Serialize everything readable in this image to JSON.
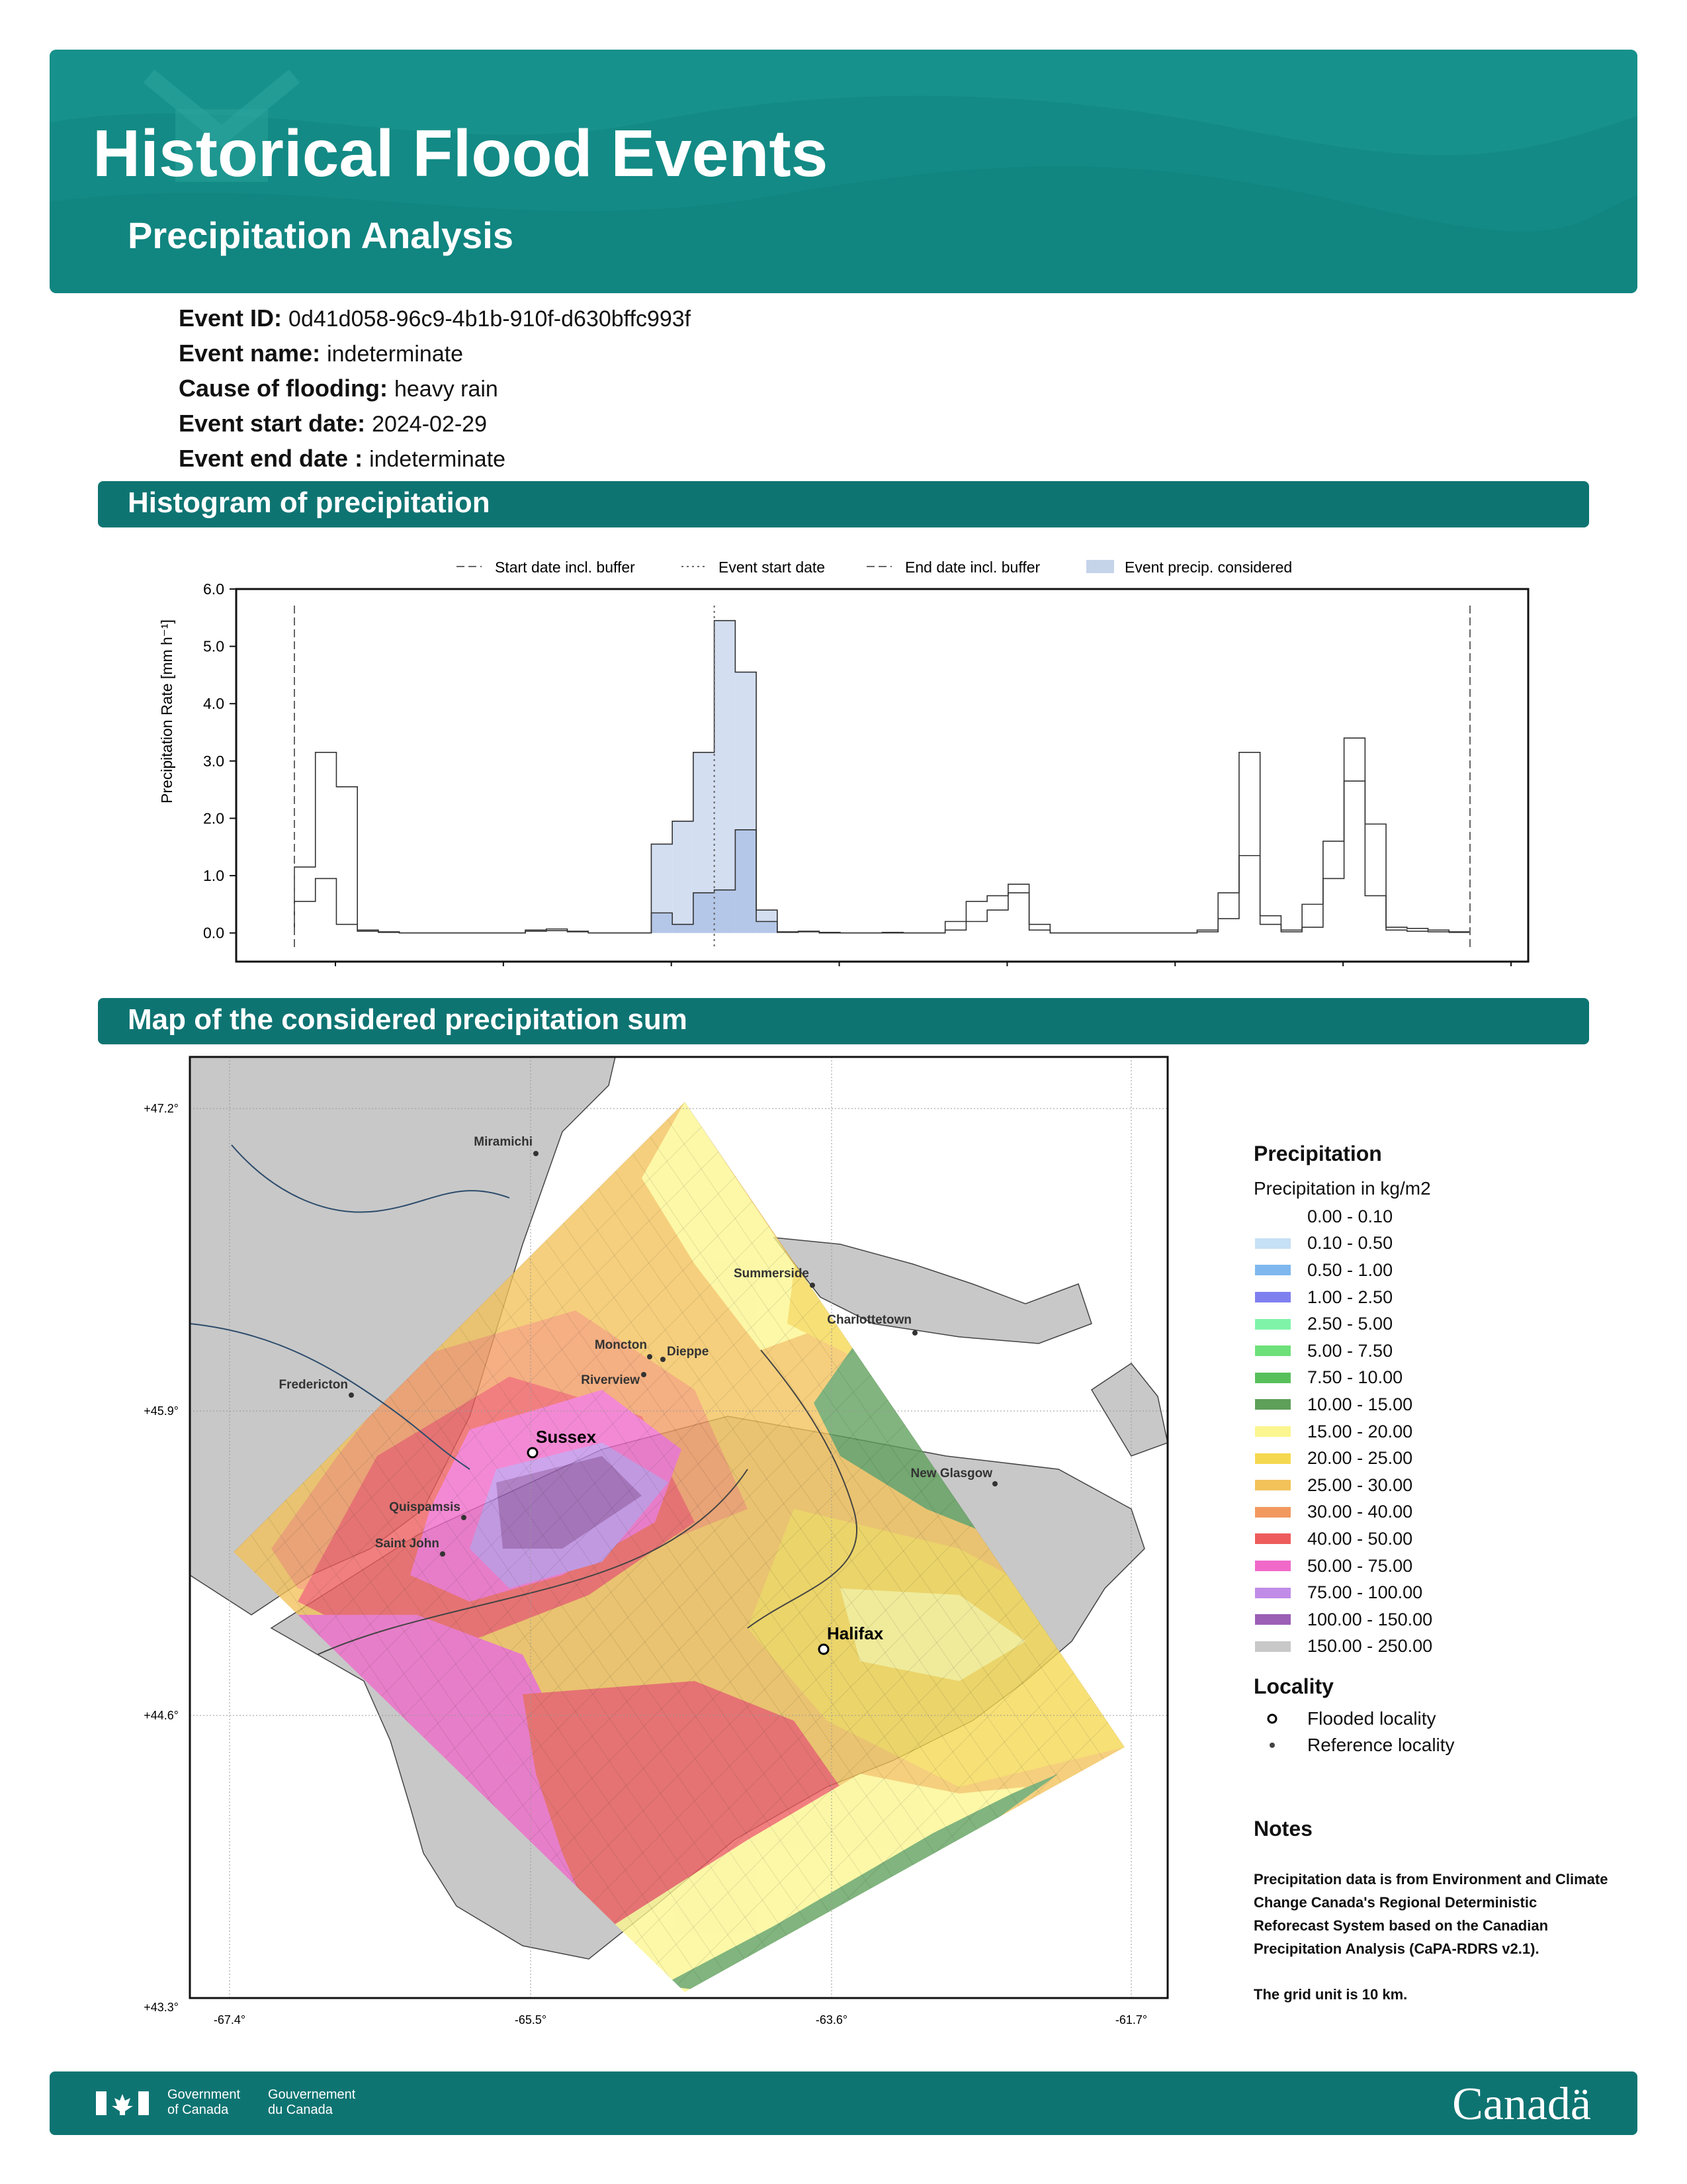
{
  "header": {
    "title": "Historical Flood Events",
    "subtitle": "Precipitation Analysis"
  },
  "event": {
    "id_label": "Event ID:",
    "id": "0d41d058-96c9-4b1b-910f-d630bffc993f",
    "name_label": "Event name:",
    "name": "indeterminate",
    "cause_label": "Cause of flooding:",
    "cause": "heavy rain",
    "start_label": "Event start date:",
    "start": "2024-02-29",
    "end_label": "Event end date :",
    "end": "indeterminate"
  },
  "sections": {
    "histogram": "Histogram of precipitation",
    "map": "Map of the considered precipitation sum"
  },
  "chart_data": {
    "type": "bar",
    "title": "",
    "xlabel": "",
    "ylabel": "Precipitation Rate [mm h⁻¹]",
    "ylim": [
      -0.5,
      6.0
    ],
    "yticks": [
      "0.0",
      "1.0",
      "2.0",
      "3.0",
      "4.0",
      "5.0",
      "6.0"
    ],
    "legend_position": "top-center",
    "legend": [
      "Start date incl. buffer",
      "Event start date",
      "End date incl. buffer",
      "Event precip. considered"
    ],
    "x_unit": "hour index (3-hourly bins)",
    "x_range": [
      0,
      56
    ],
    "markers": {
      "start_buffer": 0,
      "event_start": 20,
      "end_buffer": 56
    },
    "series": [
      {
        "values": [
          1.15,
          3.15,
          2.55,
          0.05,
          0.02,
          0.0,
          0.0,
          0.0,
          0.0,
          0.0,
          0.0,
          0.05,
          0.07,
          0.03,
          0.0,
          0.0,
          0.0,
          1.55,
          1.95,
          3.15,
          5.45,
          4.55,
          0.4,
          0.02,
          0.03,
          0.01,
          0.0,
          0.0,
          0.01,
          0.0,
          0.0,
          0.2,
          0.55,
          0.65,
          0.85,
          0.15,
          0.0,
          0.0,
          0.0,
          0.0,
          0.0,
          0.0,
          0.0,
          0.05,
          0.7,
          3.15,
          0.3,
          0.05,
          0.5,
          1.6,
          3.4,
          1.9,
          0.1,
          0.08,
          0.05,
          0.02
        ]
      },
      {
        "values": [
          0.55,
          0.95,
          0.15,
          0.03,
          0.01,
          0.0,
          0.0,
          0.0,
          0.0,
          0.0,
          0.0,
          0.03,
          0.04,
          0.02,
          0.0,
          0.0,
          0.0,
          0.35,
          0.15,
          0.7,
          0.75,
          1.8,
          0.2,
          0.01,
          0.02,
          0.0,
          0.0,
          0.0,
          0.0,
          0.0,
          0.0,
          0.05,
          0.2,
          0.4,
          0.7,
          0.05,
          0.0,
          0.0,
          0.0,
          0.0,
          0.0,
          0.0,
          0.0,
          0.02,
          0.25,
          1.35,
          0.15,
          0.02,
          0.1,
          0.95,
          2.65,
          0.65,
          0.05,
          0.03,
          0.02,
          0.01
        ]
      }
    ],
    "considered_range": [
      17,
      23
    ]
  },
  "map": {
    "lat_ticks": [
      "+47.2°",
      "+45.9°",
      "+44.6°",
      "+43.3°"
    ],
    "lon_ticks": [
      "-67.4°",
      "-65.5°",
      "-63.6°",
      "-61.7°"
    ],
    "flooded": [
      {
        "name": "Sussex"
      },
      {
        "name": "Halifax"
      }
    ],
    "reference": [
      {
        "name": "Miramichi"
      },
      {
        "name": "Summerside"
      },
      {
        "name": "Charlottetown"
      },
      {
        "name": "Moncton"
      },
      {
        "name": "Dieppe"
      },
      {
        "name": "Riverview"
      },
      {
        "name": "Fredericton"
      },
      {
        "name": "Quispamsis"
      },
      {
        "name": "Saint John"
      },
      {
        "name": "New Glasgow"
      }
    ]
  },
  "legend": {
    "title": "Precipitation",
    "subtitle": "Precipitation in kg/m2",
    "classes": [
      {
        "label": "0.00 - 0.10",
        "color": "#ffffff"
      },
      {
        "label": "0.10 - 0.50",
        "color": "#c6e0f5"
      },
      {
        "label": "0.50 - 1.00",
        "color": "#7fb8ee"
      },
      {
        "label": "1.00 - 2.50",
        "color": "#7f7ff0"
      },
      {
        "label": "2.50 - 5.00",
        "color": "#7ff4a8"
      },
      {
        "label": "5.00 - 7.50",
        "color": "#6ee07a"
      },
      {
        "label": "7.50 - 10.00",
        "color": "#58c05a"
      },
      {
        "label": "10.00 - 15.00",
        "color": "#5e9f5a"
      },
      {
        "label": "15.00 - 20.00",
        "color": "#fbf68f"
      },
      {
        "label": "20.00 - 25.00",
        "color": "#f5d850"
      },
      {
        "label": "25.00 - 30.00",
        "color": "#f3c259"
      },
      {
        "label": "30.00 - 40.00",
        "color": "#f29960"
      },
      {
        "label": "40.00 - 50.00",
        "color": "#ee5c5c"
      },
      {
        "label": "50.00 - 75.00",
        "color": "#f069c9"
      },
      {
        "label": "75.00 - 100.00",
        "color": "#c08ce8"
      },
      {
        "label": "100.00 - 150.00",
        "color": "#9b5fb5"
      },
      {
        "label": "150.00 - 250.00",
        "color": "#c8c8c8"
      }
    ],
    "locality_title": "Locality",
    "flooded_label": "Flooded locality",
    "reference_label": "Reference locality",
    "notes_title": "Notes",
    "notes_text": "Precipitation data is from Environment and Climate Change Canada's Regional Deterministic Reforecast System based on the Canadian Precipitation Analysis (CaPA-RDRS v2.1).",
    "notes_grid": "The grid unit is 10 km."
  },
  "footer": {
    "gov_en_1": "Government",
    "gov_en_2": "of Canada",
    "gov_fr_1": "Gouvernement",
    "gov_fr_2": "du Canada",
    "wordmark": "Canadä"
  }
}
